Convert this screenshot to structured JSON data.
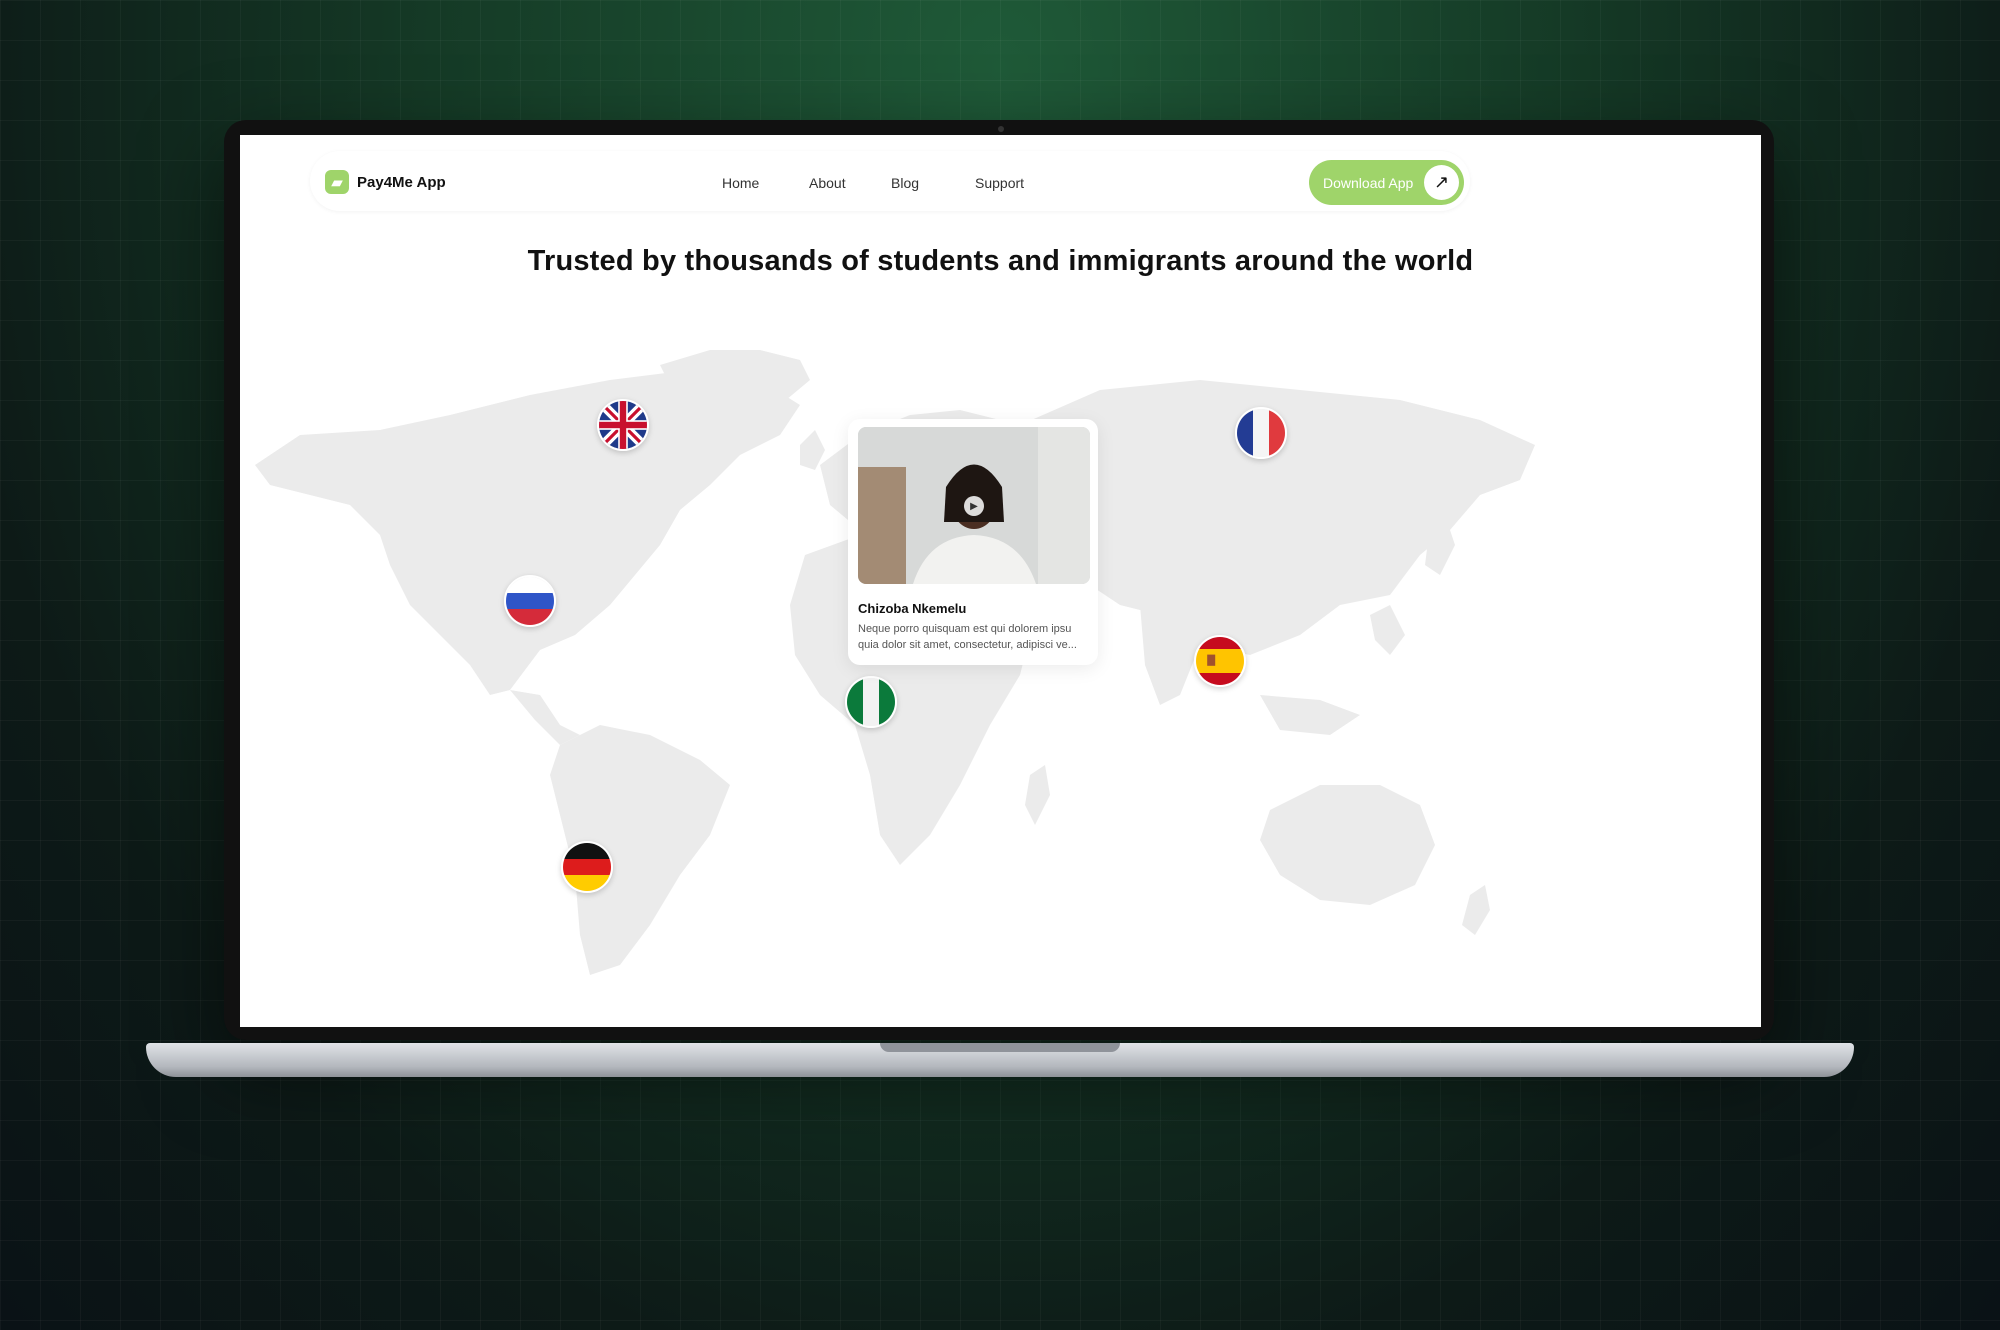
{
  "brand": {
    "name": "Pay4Me App",
    "accent": "#9fd46a"
  },
  "nav": {
    "links": [
      "Home",
      "About",
      "Blog",
      "Support"
    ],
    "cta": "Download App"
  },
  "headline": "Trusted by thousands of students and immigrants around the world",
  "testimonial": {
    "name": "Chizoba Nkemelu",
    "text": "Neque porro quisquam est qui dolorem ipsu quia dolor sit amet, consectetur, adipisci ve..."
  },
  "flags": [
    "uk-flag",
    "russia-flag",
    "germany-flag",
    "nigeria-flag",
    "france-flag",
    "spain-flag"
  ]
}
